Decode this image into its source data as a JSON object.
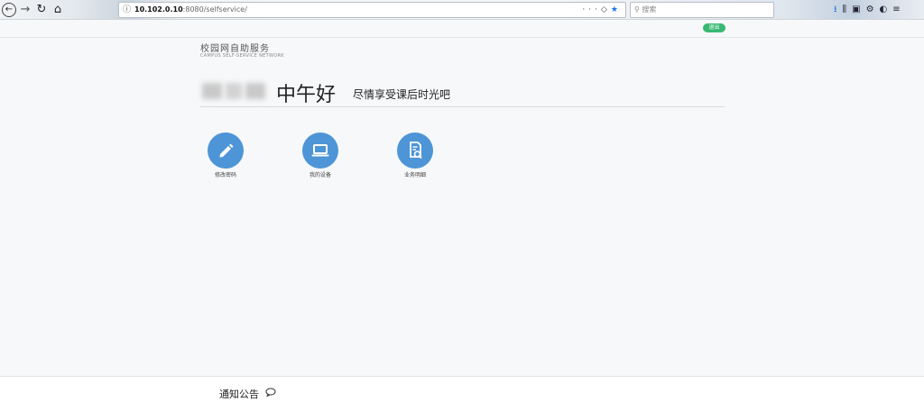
{
  "browser": {
    "url_host": "10.102.0.10",
    "url_rest": ":8080/selfservice/",
    "search_placeholder": "搜索",
    "page_actions_icon": "···"
  },
  "header": {
    "logout_label": "退出"
  },
  "brand": {
    "title": "校园网自助服务",
    "subtitle": "CAMPUS SELF-SERVICE NETWORK"
  },
  "greeting": {
    "main": "中午好",
    "sub": "尽情享受课后时光吧"
  },
  "tiles": [
    {
      "label": "修改密码",
      "icon": "pencil-icon"
    },
    {
      "label": "我的设备",
      "icon": "laptop-icon"
    },
    {
      "label": "业务明细",
      "icon": "document-search-icon"
    }
  ],
  "footer": {
    "notice_label": "通知公告",
    "notice_icon": "speech-bubble-icon"
  },
  "colors": {
    "accent_blue": "#4d95d7",
    "logout_green": "#38b873"
  }
}
